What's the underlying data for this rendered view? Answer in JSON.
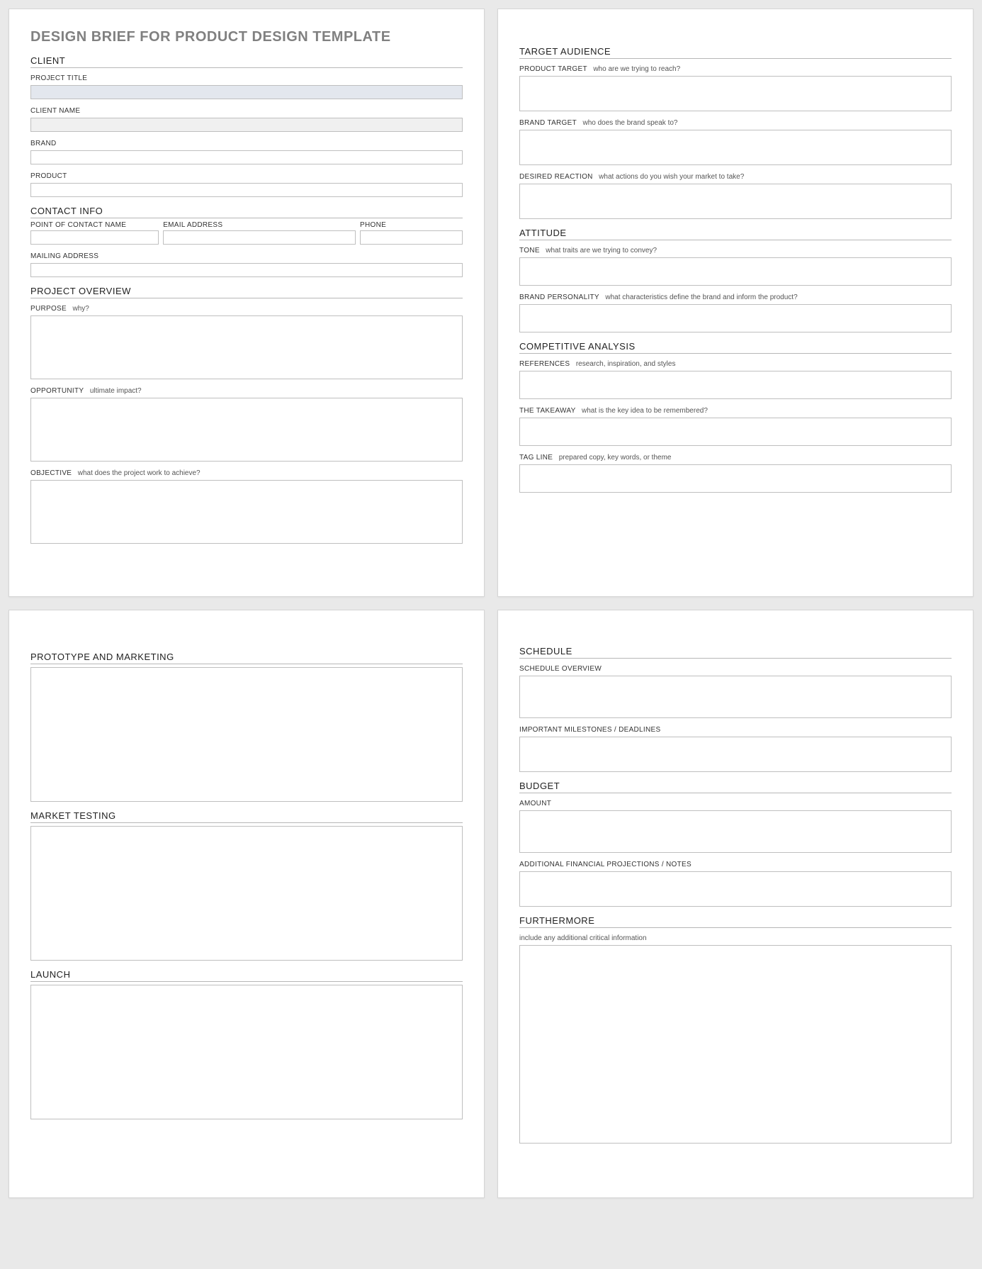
{
  "title": "DESIGN BRIEF FOR PRODUCT DESIGN TEMPLATE",
  "page1": {
    "client": {
      "head": "CLIENT",
      "project_title": "PROJECT TITLE",
      "client_name": "CLIENT NAME",
      "brand": "BRAND",
      "product": "PRODUCT"
    },
    "contact": {
      "head": "CONTACT INFO",
      "poc": "POINT OF CONTACT NAME",
      "email": "EMAIL ADDRESS",
      "phone": "PHONE",
      "mailing": "MAILING ADDRESS"
    },
    "overview": {
      "head": "PROJECT OVERVIEW",
      "purpose": "PURPOSE",
      "purpose_hint": "why?",
      "opportunity": "OPPORTUNITY",
      "opportunity_hint": "ultimate impact?",
      "objective": "OBJECTIVE",
      "objective_hint": "what does the project work to achieve?"
    }
  },
  "page2": {
    "audience": {
      "head": "TARGET AUDIENCE",
      "product_target": "PRODUCT TARGET",
      "product_target_hint": "who are we trying to reach?",
      "brand_target": "BRAND TARGET",
      "brand_target_hint": "who does the brand speak to?",
      "desired": "DESIRED REACTION",
      "desired_hint": "what actions do you wish your market to take?"
    },
    "attitude": {
      "head": "ATTITUDE",
      "tone": "TONE",
      "tone_hint": "what traits are we trying to convey?",
      "personality": "BRAND PERSONALITY",
      "personality_hint": "what characteristics define the brand and inform the product?"
    },
    "competitive": {
      "head": "COMPETITIVE ANALYSIS",
      "references": "REFERENCES",
      "references_hint": "research, inspiration, and styles",
      "takeaway": "THE TAKEAWAY",
      "takeaway_hint": "what is the key idea to be remembered?",
      "tagline": "TAG LINE",
      "tagline_hint": "prepared copy, key words, or theme"
    }
  },
  "page3": {
    "proto": "PROTOTYPE AND MARKETING",
    "market": "MARKET TESTING",
    "launch": "LAUNCH"
  },
  "page4": {
    "schedule": {
      "head": "SCHEDULE",
      "overview": "SCHEDULE OVERVIEW",
      "milestones": "IMPORTANT MILESTONES / DEADLINES"
    },
    "budget": {
      "head": "BUDGET",
      "amount": "AMOUNT",
      "notes": "ADDITIONAL FINANCIAL PROJECTIONS / NOTES"
    },
    "furthermore": {
      "head": "FURTHERMORE",
      "hint": "include any additional critical information"
    }
  }
}
